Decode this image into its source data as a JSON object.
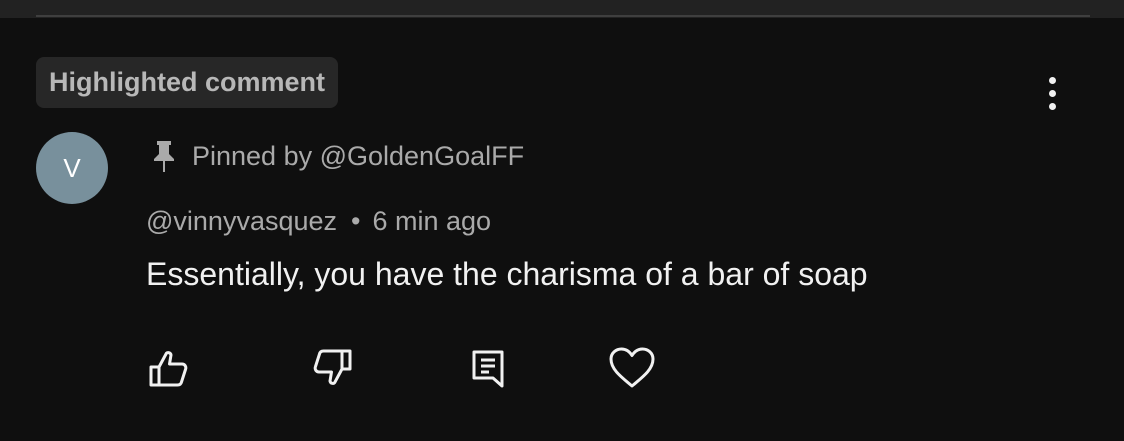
{
  "comment": {
    "highlight_label": "Highlighted comment",
    "avatar_letter": "V",
    "pinned_text": "Pinned by @GoldenGoalFF",
    "author": "@vinnyvasquez",
    "separator": "•",
    "timestamp": "6 min ago",
    "body": "Essentially, you have the charisma of a bar of soap"
  },
  "icons": {
    "pin": "pin-icon",
    "more": "more-vertical-icon",
    "like": "thumbs-up-icon",
    "dislike": "thumbs-down-icon",
    "reply": "reply-icon",
    "heart": "heart-icon"
  },
  "colors": {
    "background": "#0f0f0f",
    "chip_background": "#272727",
    "avatar_background": "#78909c",
    "secondary_text": "#aaaaaa",
    "primary_text": "#f1f1f1"
  }
}
